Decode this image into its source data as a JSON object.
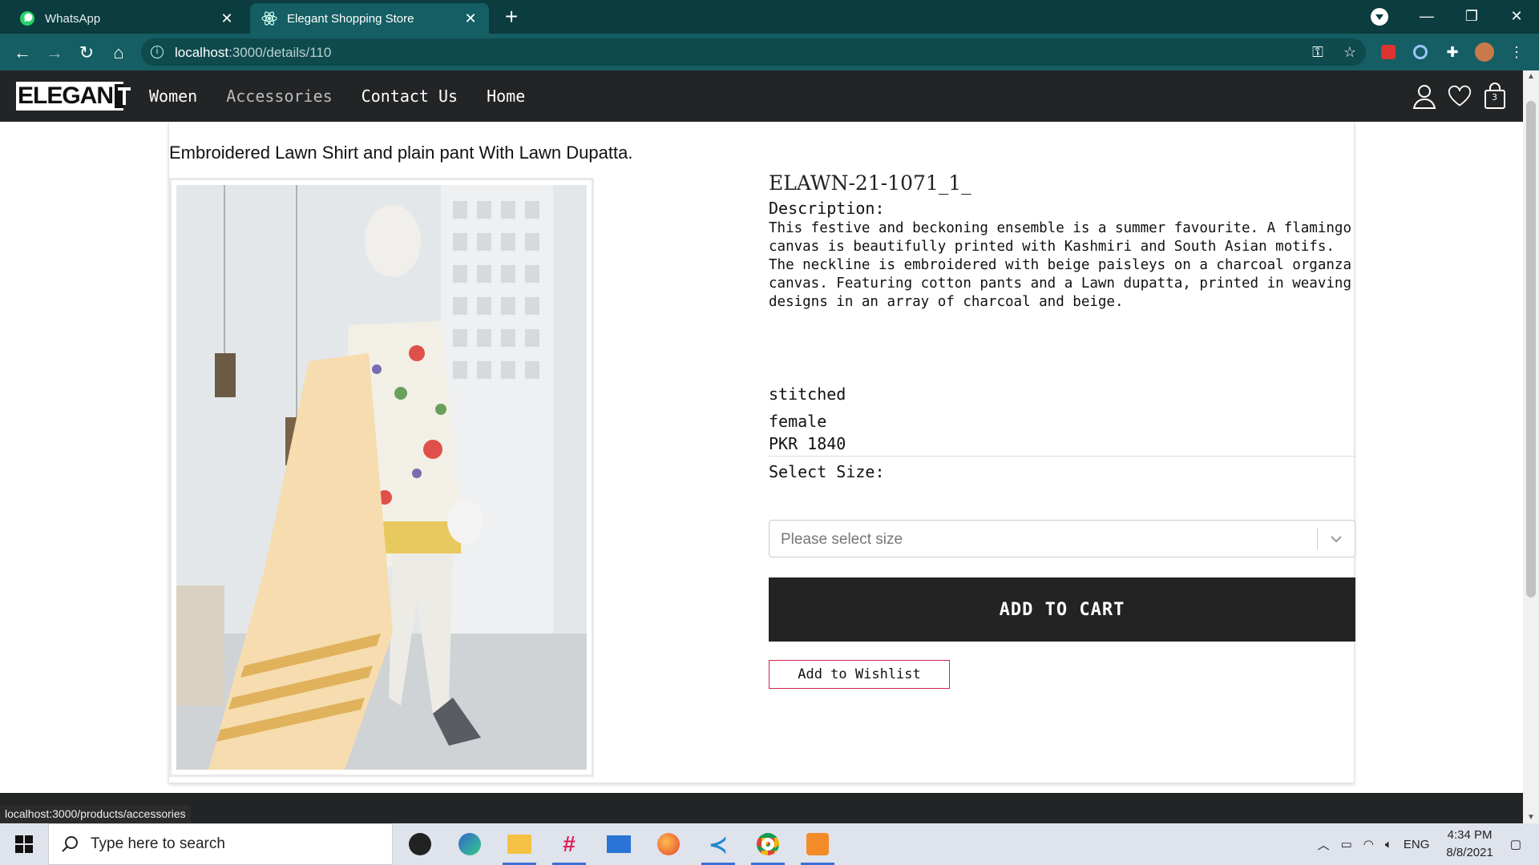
{
  "browser": {
    "tabs": [
      {
        "title": "WhatsApp",
        "active": false
      },
      {
        "title": "Elegant Shopping Store",
        "active": true
      }
    ],
    "url_host": "localhost",
    "url_rest": ":3000/details/110",
    "status_url": "localhost:3000/products/accessories"
  },
  "site": {
    "logo": "ELEGAN",
    "nav": [
      "Women",
      "Accessories",
      "Contact Us",
      "Home"
    ],
    "cart_count": "3"
  },
  "product": {
    "title": "Embroidered Lawn Shirt and plain pant With Lawn Dupatta.",
    "sku": "ELAWN-21-1071_1_",
    "description_label": "Description:",
    "description": "This festive and beckoning ensemble is a summer favourite. A flamingo canvas is beautifully printed with Kashmiri and South Asian motifs. The neckline is embroidered with beige paisleys on a charcoal organza canvas. Featuring cotton pants and a Lawn dupatta, printed in weaving designs in an array of charcoal and beige.",
    "stitch_type": "stitched",
    "gender": "female",
    "price": "PKR 1840",
    "size_label": "Select Size:",
    "size_placeholder": "Please select size",
    "add_to_cart": "ADD TO CART",
    "add_to_wishlist": "Add to Wishlist"
  },
  "taskbar": {
    "search_placeholder": "Type here to search",
    "language": "ENG",
    "time": "4:34 PM",
    "date": "8/8/2021"
  },
  "colors": {
    "chrome_dark": "#0b3c3f",
    "chrome_toolbar": "#155e63",
    "site_nav": "#222426",
    "wishlist_border": "#d0244d"
  }
}
